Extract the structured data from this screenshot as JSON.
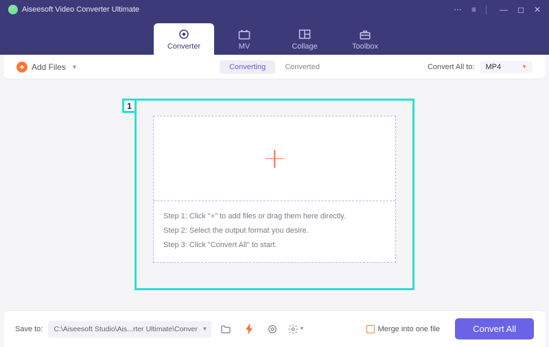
{
  "titlebar": {
    "appName": "Aiseesoft Video Converter Ultimate"
  },
  "tabs": {
    "converter": "Converter",
    "mv": "MV",
    "collage": "Collage",
    "toolbox": "Toolbox"
  },
  "toolbar": {
    "addFiles": "Add Files",
    "converting": "Converting",
    "converted": "Converted",
    "convertAllTo": "Convert All to:",
    "format": "MP4"
  },
  "annotation": {
    "badge": "1"
  },
  "steps": {
    "s1": "Step 1: Click \"+\" to add files or drag them here directly.",
    "s2": "Step 2: Select the output format you desire.",
    "s3": "Step 3: Click \"Convert All\" to start."
  },
  "footer": {
    "saveToLabel": "Save to:",
    "path": "C:\\Aiseesoft Studio\\Ais...rter Ultimate\\Converted",
    "merge": "Merge into one file",
    "convertAll": "Convert All"
  }
}
